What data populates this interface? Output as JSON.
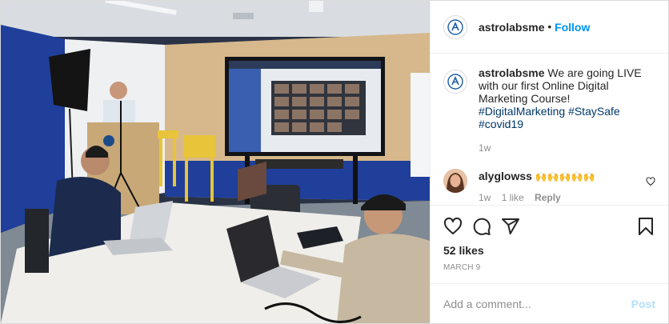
{
  "header": {
    "username": "astrolabsme",
    "separator": "•",
    "follow_label": "Follow"
  },
  "caption": {
    "username": "astrolabsme",
    "text": "We are going LIVE with our first Online Digital Marketing Course!",
    "hashtags": [
      "#DigitalMarketing",
      "#StaySafe",
      "#covid19"
    ],
    "time": "1w"
  },
  "comment": {
    "username": "alyglowss",
    "text": "🙌🙌🙌🙌🙌",
    "time": "1w",
    "likes": "1 like",
    "reply_label": "Reply"
  },
  "post": {
    "likes": "52 likes",
    "date": "MARCH 9"
  },
  "add_comment": {
    "placeholder": "Add a comment...",
    "post_label": "Post"
  },
  "icons": {
    "like": "heart-icon",
    "comment": "comment-bubble-icon",
    "share": "paper-plane-icon",
    "save": "bookmark-icon",
    "comment_like": "small-heart-icon"
  },
  "colors": {
    "accent": "#0095f6",
    "hashtag": "#00376b",
    "muted": "#8e8e8e",
    "post_disabled": "#b2dffc",
    "brand": "#1d5fa8"
  }
}
